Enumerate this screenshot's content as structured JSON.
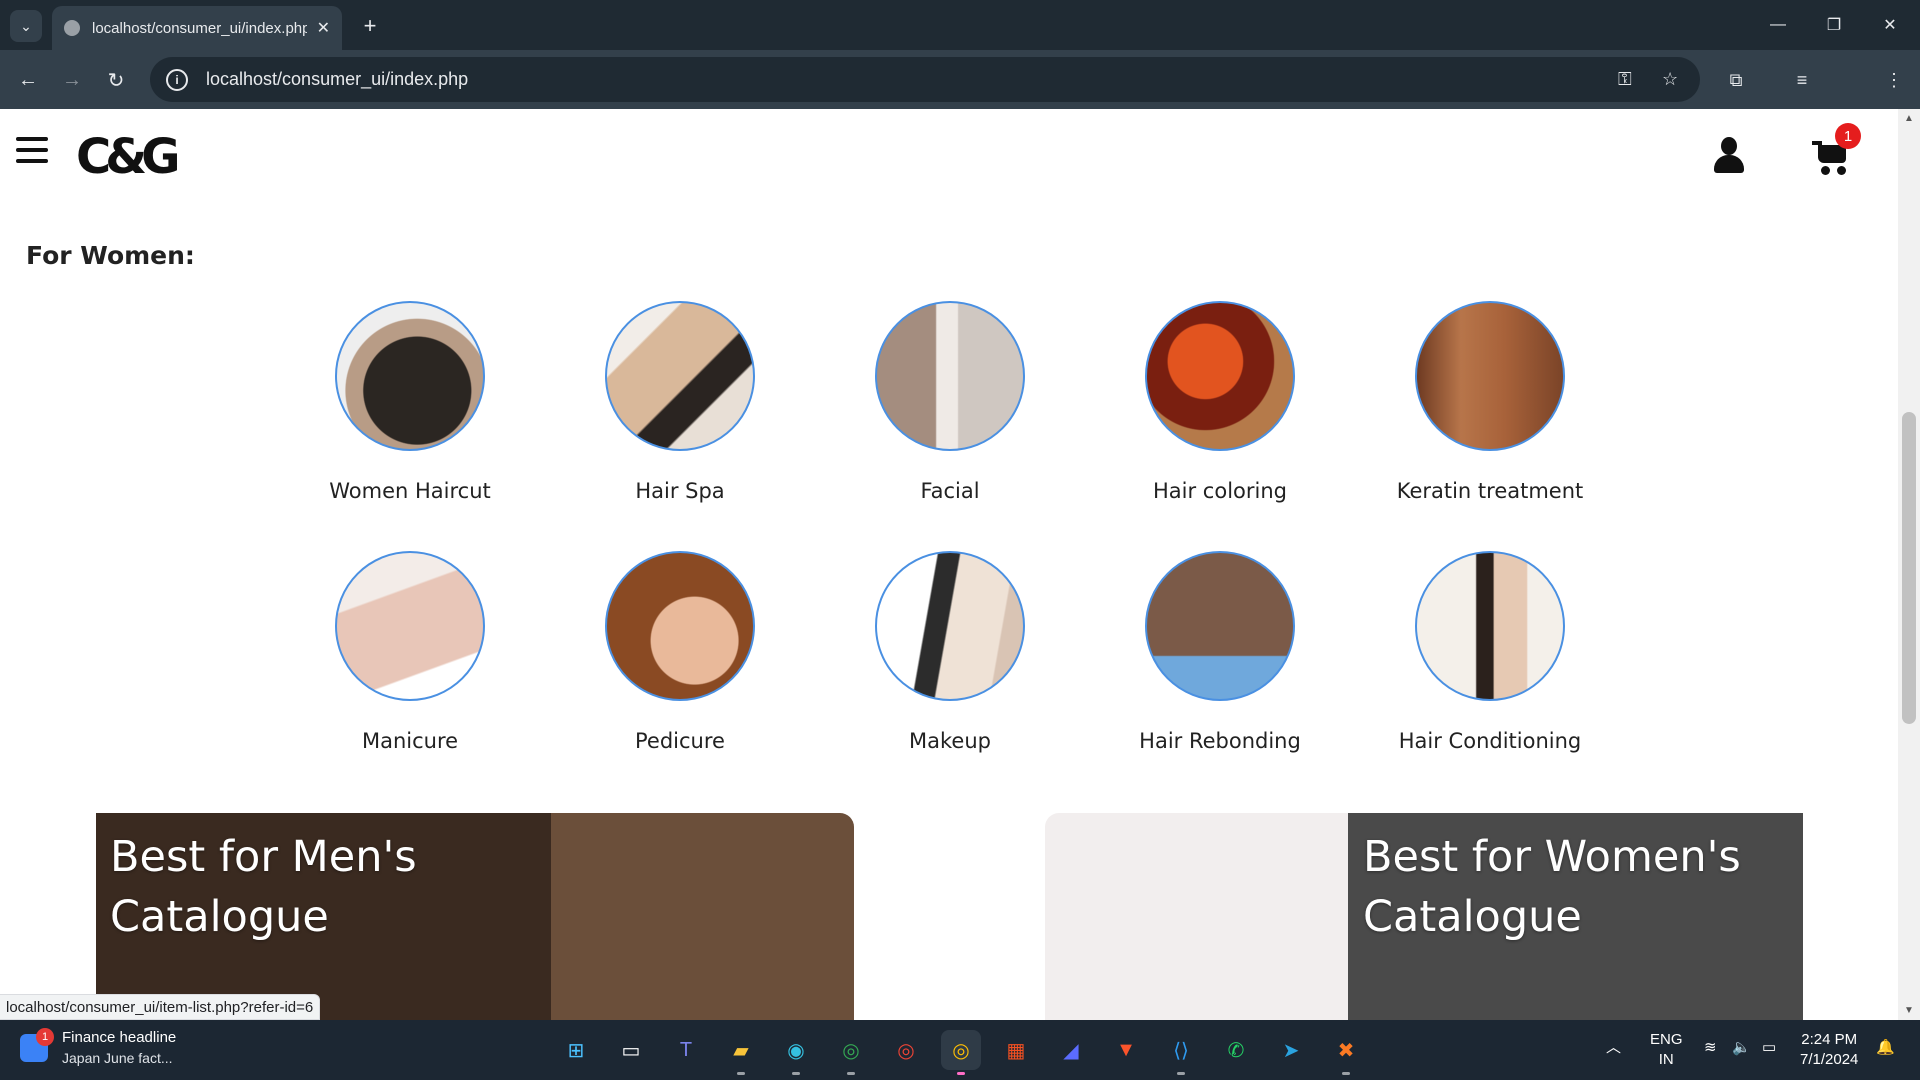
{
  "browser": {
    "tab_title": "localhost/consumer_ui/index.php",
    "url": "localhost/consumer_ui/index.php",
    "status_url": "localhost/consumer_ui/item-list.php?refer-id=6"
  },
  "site": {
    "logo_text": "C&G",
    "cart_count": "1",
    "section_title": "For Women:",
    "services": [
      {
        "label": "Women Haircut",
        "color": "#2b2622"
      },
      {
        "label": "Hair Spa",
        "color": "#d9b89a"
      },
      {
        "label": "Facial",
        "color": "#c9b6a6"
      },
      {
        "label": "Hair coloring",
        "color": "#b0401d"
      },
      {
        "label": "Keratin treatment",
        "color": "#a8623a"
      },
      {
        "label": "Manicure",
        "color": "#e8c6b8"
      },
      {
        "label": "Pedicure",
        "color": "#c7895f"
      },
      {
        "label": "Makeup",
        "color": "#efe6df"
      },
      {
        "label": "Hair Rebonding",
        "color": "#5a4034"
      },
      {
        "label": "Hair Conditioning",
        "color": "#e9e3dc"
      }
    ],
    "banners": [
      {
        "line1": "Best for Men's",
        "line2": "Catalogue"
      },
      {
        "line1": "Best for Women's",
        "line2": "Catalogue"
      }
    ]
  },
  "taskbar": {
    "news_title": "Finance headline",
    "news_sub": "Japan June fact...",
    "news_badge": "1",
    "lang_top": "ENG",
    "lang_bottom": "IN",
    "time": "2:24 PM",
    "date": "7/1/2024"
  },
  "colors": {
    "accent_border": "#4a90e2",
    "badge_red": "#e51d1d"
  }
}
